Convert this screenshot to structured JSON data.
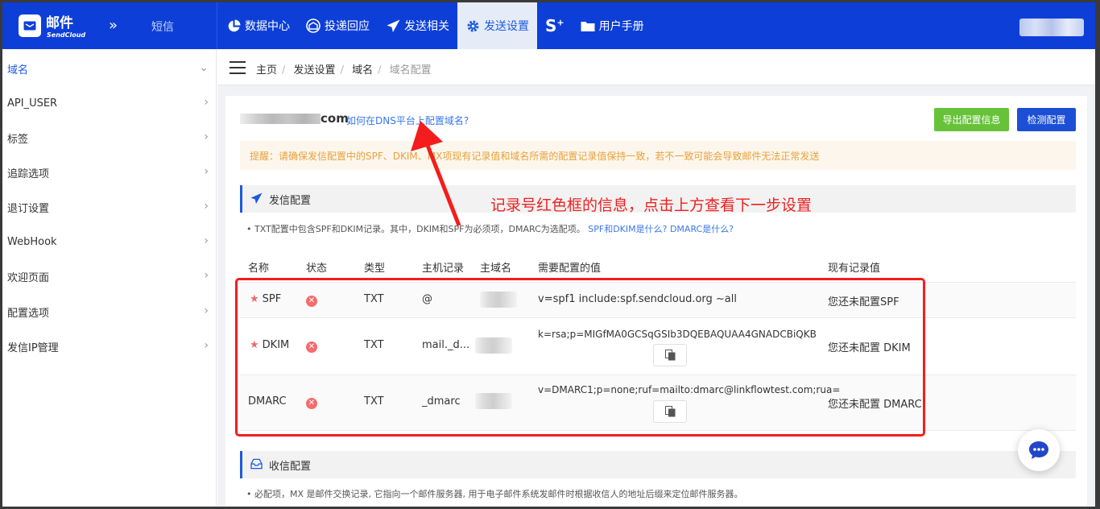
{
  "brand": {
    "name": "邮件",
    "sub": "SendCloud",
    "sms": "短信"
  },
  "nav": {
    "items": [
      {
        "label": "数据中心",
        "icon": "pie-chart-icon"
      },
      {
        "label": "投递回应",
        "icon": "inbox-icon"
      },
      {
        "label": "发送相关",
        "icon": "send-icon"
      },
      {
        "label": "发送设置",
        "icon": "gear-icon",
        "active": true
      },
      {
        "label": "",
        "icon": "s-plus-icon"
      },
      {
        "label": "用户手册",
        "icon": "folder-icon"
      }
    ]
  },
  "sidebar": {
    "items": [
      {
        "label": "域名",
        "active": true,
        "chevron": "down"
      },
      {
        "label": "API_USER"
      },
      {
        "label": "标签"
      },
      {
        "label": "追踪选项"
      },
      {
        "label": "退订设置"
      },
      {
        "label": "WebHook"
      },
      {
        "label": "欢迎页面"
      },
      {
        "label": "配置选项"
      },
      {
        "label": "发信IP管理"
      }
    ]
  },
  "breadcrumb": [
    "主页",
    "发送设置",
    "域名",
    "域名配置"
  ],
  "domain": {
    "tld": "com",
    "help_link": "如何在DNS平台上配置域名?"
  },
  "buttons": {
    "export": "导出配置信息",
    "check": "检测配置"
  },
  "warning": "提醒：请确保发信配置中的SPF、DKIM、MX项现有记录值和域名所需的配置记录值保持一致，若不一致可能会导致邮件无法正常发送",
  "send_section": {
    "title": "发信配置",
    "note": "• TXT配置中包含SPF和DKIM记录。其中，DKIM和SPF为必须项，DMARC为选配项。",
    "link1": "SPF和DKIM是什么?",
    "link2": "DMARC是什么?"
  },
  "table": {
    "headers": [
      "名称",
      "状态",
      "类型",
      "主机记录",
      "主域名",
      "需要配置的值",
      "现有记录值"
    ],
    "rows": [
      {
        "name": "SPF",
        "required": true,
        "type": "TXT",
        "host": "@",
        "value": "v=spf1 include:spf.sendcloud.org ~all",
        "current": "您还未配置SPF"
      },
      {
        "name": "DKIM",
        "required": true,
        "type": "TXT",
        "host": "mail._d...",
        "value": "k=rsa;p=MIGfMA0GCSqGSIb3DQEBAQUAA4GNADCBiQKB",
        "current": "您还未配置 DKIM"
      },
      {
        "name": "DMARC",
        "required": false,
        "type": "TXT",
        "host": "_dmarc",
        "value": "v=DMARC1;p=none;ruf=mailto:dmarc@linkflowtest.com;rua=",
        "current": "您还未配置 DMARC"
      }
    ]
  },
  "recv_section": {
    "title": "收信配置",
    "note": "• 必配项，MX 是邮件交换记录, 它指向一个邮件服务器, 用于电子邮件系统发邮件时根据收信人的地址后缀来定位邮件服务器。"
  },
  "annotation": "记录号红色框的信息，点击上方查看下一步设置",
  "colors": {
    "topbar": "#0d3fd8",
    "accent": "#1d5ae0",
    "annotation": "#f41d1d",
    "export": "#67c23a",
    "warning": "#e6a23c"
  }
}
